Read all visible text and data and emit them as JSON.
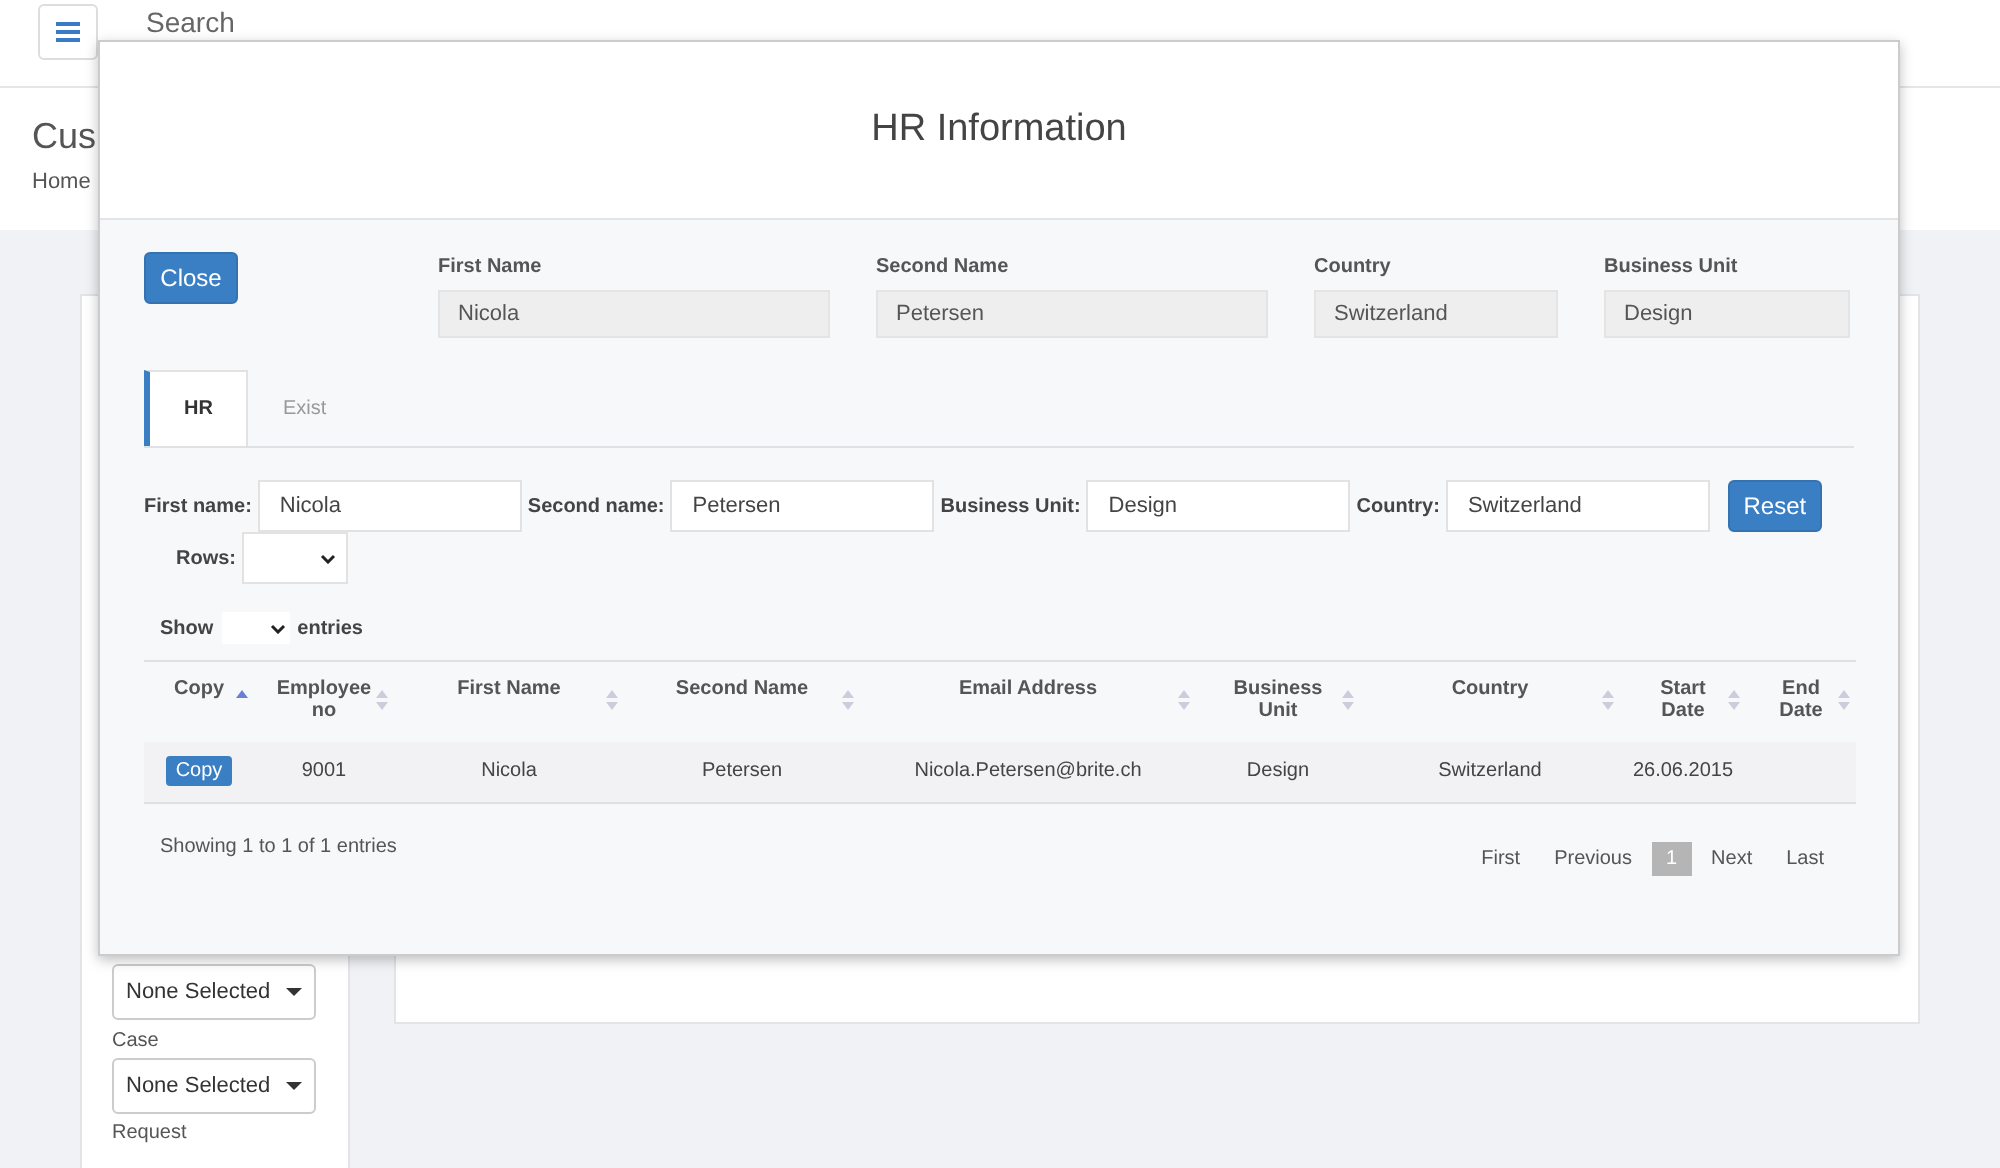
{
  "background": {
    "search": {
      "placeholder": "Search"
    },
    "page_title": "Cus",
    "breadcrumb": "Home",
    "filters": [
      {
        "value": "None Selected"
      },
      {
        "label": "Case",
        "value": "None Selected"
      }
    ],
    "cut_label": "Request"
  },
  "modal": {
    "title": "HR Information",
    "close_button": "Close",
    "summary": [
      {
        "label": "First Name",
        "value": "Nicola"
      },
      {
        "label": "Second Name",
        "value": "Petersen"
      },
      {
        "label": "Country",
        "value": "Switzerland"
      },
      {
        "label": "Business Unit",
        "value": "Design"
      }
    ],
    "tabs": [
      {
        "label": "HR",
        "selected": true
      },
      {
        "label": "Exist",
        "selected": false
      }
    ],
    "filters": [
      {
        "label": "First name:",
        "value": "Nicola"
      },
      {
        "label": "Second name:",
        "value": "Petersen"
      },
      {
        "label": "Business Unit:",
        "value": "Design"
      },
      {
        "label": "Country:",
        "value": "Switzerland"
      }
    ],
    "reset_button": "Reset",
    "rows_label": "Rows:",
    "show_label": "Show",
    "entries_label": "entries",
    "table": {
      "columns": [
        {
          "label": "Copy",
          "sorted": true
        },
        {
          "label": "Employee no",
          "sorted": false
        },
        {
          "label": "First Name",
          "sorted": false
        },
        {
          "label": "Second Name",
          "sorted": false
        },
        {
          "label": "Email Address",
          "sorted": false
        },
        {
          "label": "Business Unit",
          "sorted": false
        },
        {
          "label": "Country",
          "sorted": false
        },
        {
          "label": "Start Date",
          "sorted": false
        },
        {
          "label": "End Date",
          "sorted": false
        }
      ],
      "rows": [
        {
          "cells": [
            "Copy",
            "9001",
            "Nicola",
            "Petersen",
            "Nicola.Petersen@brite.ch",
            "Design",
            "Switzerland",
            "26.06.2015",
            ""
          ]
        }
      ]
    },
    "info": "Showing 1 to 1 of 1 entries",
    "pagination": [
      {
        "label": "First",
        "selected": false
      },
      {
        "label": "Previous",
        "selected": false
      },
      {
        "label": "1",
        "selected": true
      },
      {
        "label": "Next",
        "selected": false
      },
      {
        "label": "Last",
        "selected": false
      }
    ]
  }
}
